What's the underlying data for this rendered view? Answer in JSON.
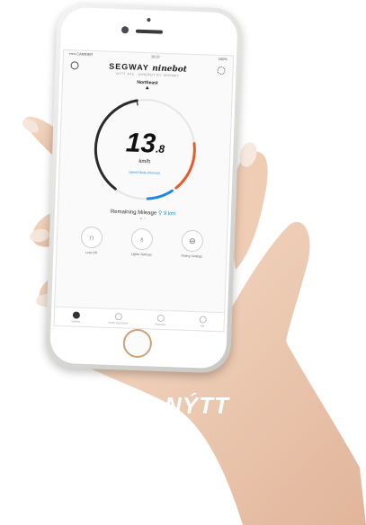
{
  "colors": {
    "skin": "#f0d2bb",
    "skin_shade": "#d9ae92",
    "gauge_track": "#2b2b2b",
    "gauge_blue": "#1e88e5",
    "gauge_red": "#e85a2a",
    "frame_gold": "#c9a27a",
    "caption": "#ffffff"
  },
  "status_bar": {
    "carrier": "••••• CARRIER",
    "time": "16:27",
    "battery": "100%"
  },
  "app": {
    "brand": "SEGWAY",
    "brand_second": "ninebot",
    "subtitle": "NYTT A25 · NINEBOT BY SEGWAY"
  },
  "dashboard": {
    "heading": "Northeast",
    "speed_int": "13",
    "speed_dec": ".8",
    "unit": "km/h",
    "mode": "Speed Mode (Normal)",
    "remaining_label": "Remaining Mileage",
    "remaining_value": "9 km",
    "speed_level": 0.46,
    "battery_level": 0.25
  },
  "actions": [
    {
      "label": "Lock Off",
      "icon": "lock-icon"
    },
    {
      "label": "Lights Settings",
      "icon": "light-bulb-icon"
    },
    {
      "label": "Riding Settings",
      "icon": "scooter-icon"
    }
  ],
  "tabs": [
    {
      "label": "Vehicle",
      "icon": "vehicle-icon"
    },
    {
      "label": "Smart Operation",
      "icon": "smart-icon"
    },
    {
      "label": "Discover",
      "icon": "discover-icon"
    },
    {
      "label": "Me",
      "icon": "me-icon"
    }
  ],
  "caption": "NÝTT"
}
